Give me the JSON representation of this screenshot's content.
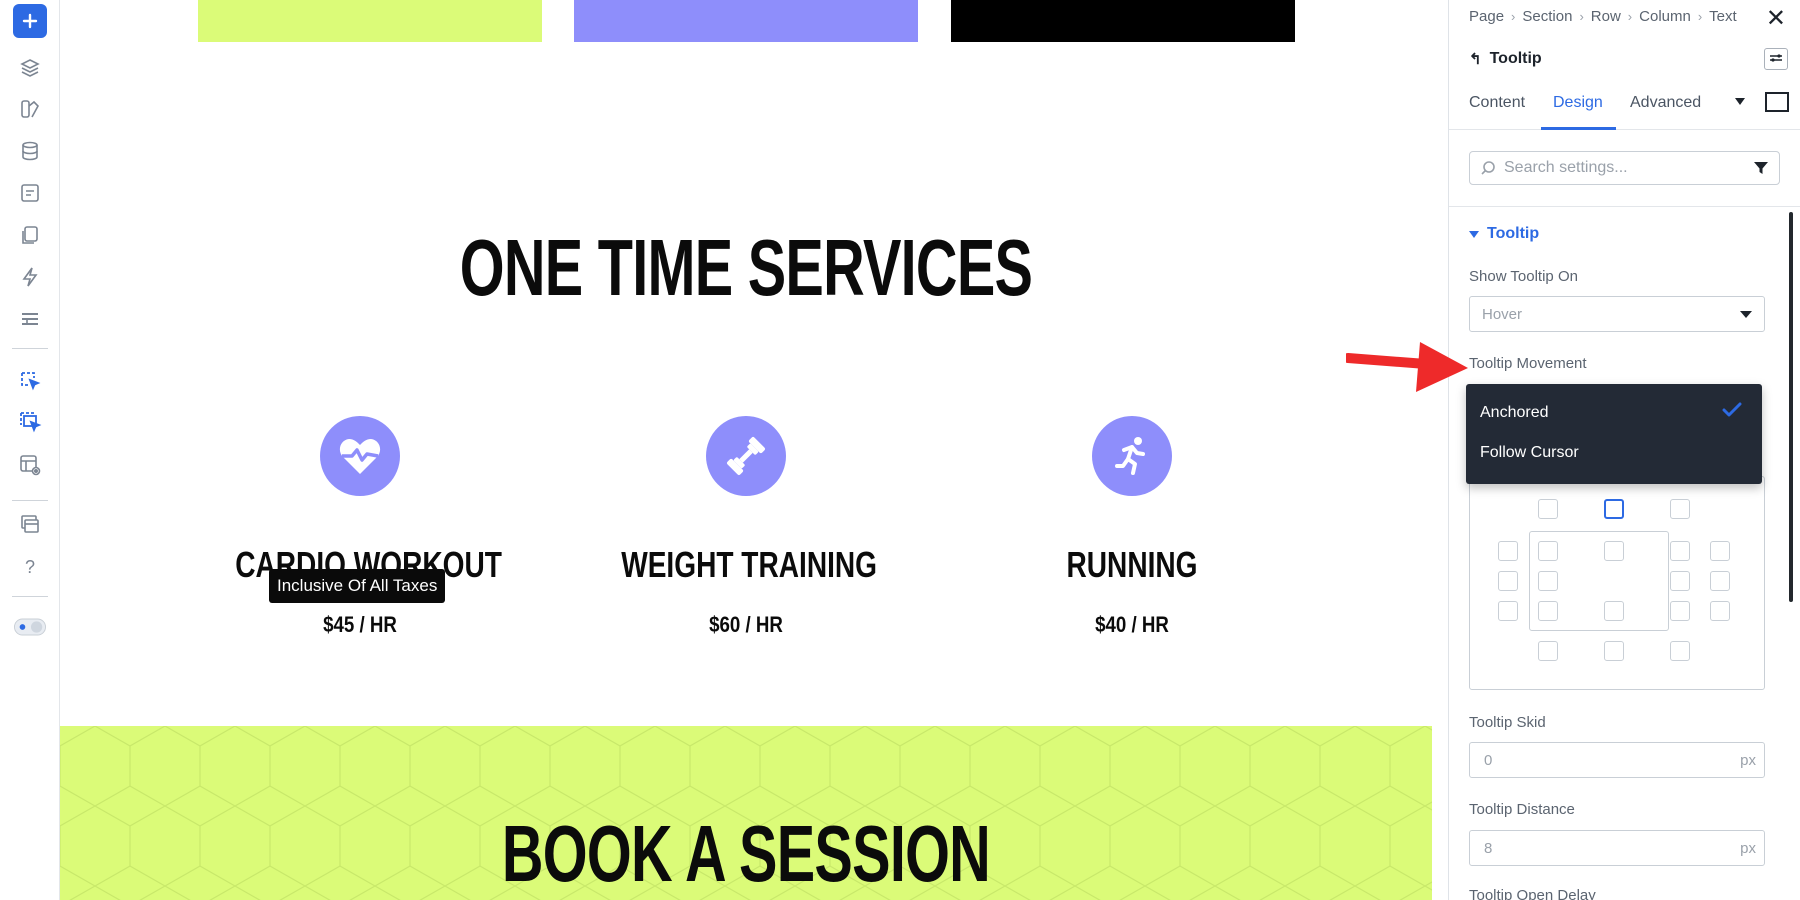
{
  "sidebar": {
    "icons": [
      "add-icon",
      "layers-icon",
      "theme-builder-icon",
      "database-icon",
      "form-icon",
      "pages-icon",
      "lightning-icon",
      "list-icon",
      "click-select-icon",
      "multi-select-icon",
      "preview-icon",
      "windows-icon",
      "help-icon",
      "theme-toggle-icon"
    ]
  },
  "canvas": {
    "swatch_colors": [
      "#dbfb78",
      "#8e8efb",
      "#000000"
    ],
    "section_title": "ONE TIME SERVICES",
    "services": [
      {
        "title": "CARDIO WORKOUT",
        "price": "$45 / HR",
        "icon": "heart-icon"
      },
      {
        "title": "WEIGHT TRAINING",
        "price": "$60 / HR",
        "icon": "dumbbell-icon"
      },
      {
        "title": "RUNNING",
        "price": "$40 / HR",
        "icon": "runner-icon"
      }
    ],
    "tooltip_text": "Inclusive Of All Taxes",
    "book_title": "BOOK A SESSION"
  },
  "panel": {
    "breadcrumbs": [
      "Page",
      "Section",
      "Row",
      "Column",
      "Text"
    ],
    "module_name": "Tooltip",
    "tabs": [
      "Content",
      "Design",
      "Advanced"
    ],
    "active_tab": "Design",
    "search_placeholder": "Search settings...",
    "section_title": "Tooltip",
    "show_tooltip_on_label": "Show Tooltip On",
    "show_tooltip_on_value": "Hover",
    "tooltip_movement_label": "Tooltip Movement",
    "movement_options": [
      "Anchored",
      "Follow Cursor"
    ],
    "movement_selected": "Anchored",
    "tooltip_skid_label": "Tooltip Skid",
    "tooltip_skid_value": "0",
    "tooltip_distance_label": "Tooltip Distance",
    "tooltip_distance_value": "8",
    "unit": "px",
    "tooltip_open_delay_label": "Tooltip Open Delay"
  },
  "colors": {
    "accent": "#2d6ae3",
    "service_icon_bg": "#8e8efb",
    "dropdown_bg": "#232a36",
    "annotation_arrow": "#ee2a2a"
  }
}
